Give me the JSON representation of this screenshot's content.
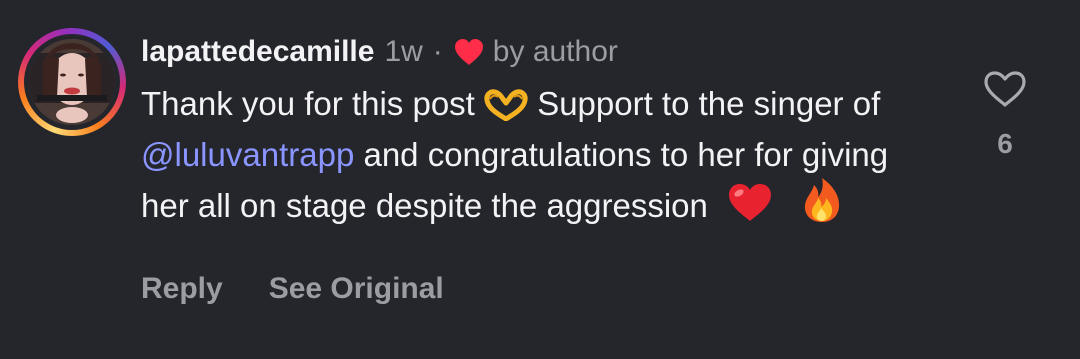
{
  "comment": {
    "username": "lapattedecamille",
    "time": "1w",
    "separator": "·",
    "author_like_label": "by author",
    "text": {
      "part1": "Thank you for this post",
      "part2": "Support to the singer of",
      "mention": "@luluvantrapp",
      "part3": "and congratulations to her for giving her all on stage despite the aggression"
    },
    "emojis": [
      "heart-hands-icon",
      "red-heart-icon",
      "fire-icon"
    ],
    "like_count": "6"
  },
  "actions": {
    "reply_label": "Reply",
    "see_original_label": "See Original"
  },
  "colors": {
    "background": "#24262c",
    "text": "#f3f3f5",
    "muted": "#9b9da3",
    "mention": "#8a95ff",
    "heart": "#ff2d47"
  }
}
